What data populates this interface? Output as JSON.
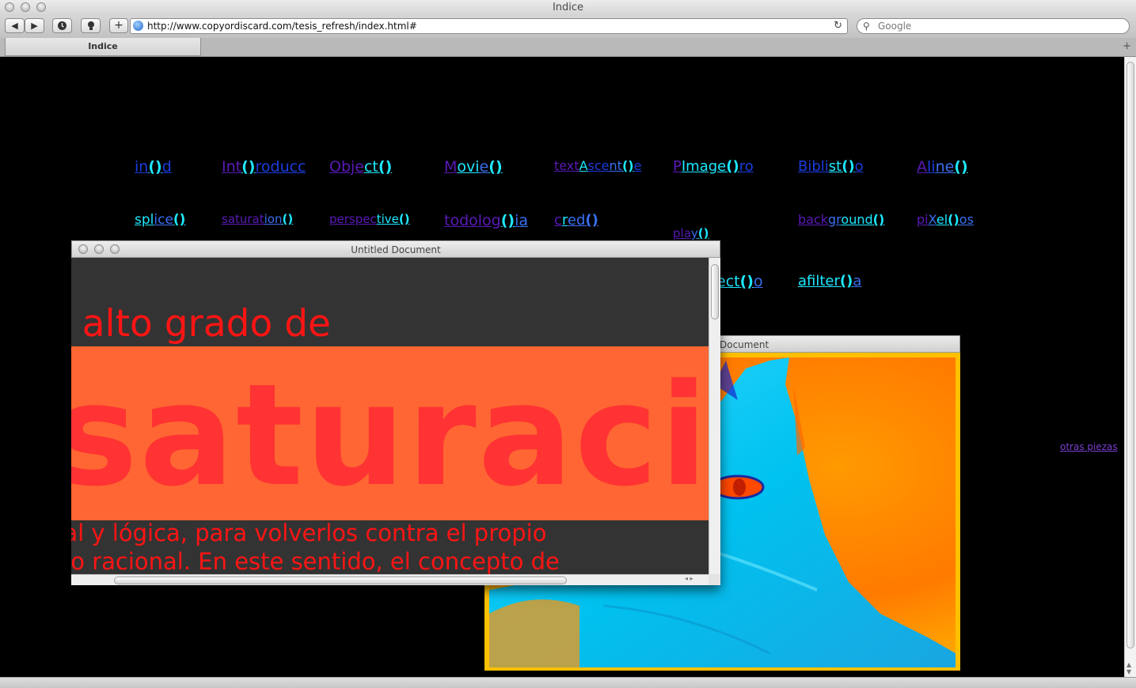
{
  "window": {
    "title": "Indice"
  },
  "toolbar": {
    "back": "◀",
    "forward": "▶",
    "add": "+",
    "url": "http://www.copyordiscard.com/tesis_refresh/index.html#",
    "reload": "↻",
    "search_placeholder": "Google"
  },
  "tab": {
    "label": "Indice",
    "new": "+"
  },
  "links": [
    {
      "name": "link-ind",
      "parts": [
        [
          "in",
          "c2"
        ],
        [
          "()",
          "c3"
        ],
        [
          "d",
          "c2"
        ]
      ]
    },
    {
      "name": "link-introduccion",
      "parts": [
        [
          "Int",
          "c1"
        ],
        [
          "()",
          "c3"
        ],
        [
          "roducc",
          "c2"
        ]
      ]
    },
    {
      "name": "link-object",
      "parts": [
        [
          "Obje",
          "c1"
        ],
        [
          "ct",
          "c3"
        ],
        [
          "()",
          "c3"
        ]
      ]
    },
    {
      "name": "link-movie",
      "parts": [
        [
          "M",
          "c1"
        ],
        [
          "ovi",
          "c3"
        ],
        [
          "e",
          "c4"
        ],
        [
          "()",
          "c3"
        ]
      ]
    },
    {
      "name": "link-textascent",
      "parts": [
        [
          "text",
          "c1"
        ],
        [
          "A",
          "c3"
        ],
        [
          "sce",
          "c2"
        ],
        [
          "nt",
          "c4"
        ],
        [
          "()",
          "c3"
        ],
        [
          "e",
          "c2"
        ]
      ]
    },
    {
      "name": "link-pimage",
      "parts": [
        [
          "P",
          "c1"
        ],
        [
          "Image",
          "c3"
        ],
        [
          "()",
          "c3"
        ],
        [
          "ro",
          "c2"
        ]
      ]
    },
    {
      "name": "link-biblist",
      "parts": [
        [
          "Bibli",
          "c2"
        ],
        [
          "st",
          "c3"
        ],
        [
          "()",
          "c3"
        ],
        [
          "o",
          "c2"
        ]
      ]
    },
    {
      "name": "link-aline",
      "parts": [
        [
          "A",
          "c1"
        ],
        [
          "li",
          "c2"
        ],
        [
          "ne",
          "c4"
        ],
        [
          "()",
          "c3"
        ]
      ]
    },
    {
      "name": "link-splice",
      "parts": [
        [
          "spl",
          "c3"
        ],
        [
          "ice",
          "c4"
        ],
        [
          "()",
          "c3"
        ]
      ]
    },
    {
      "name": "link-saturation",
      "parts": [
        [
          "saturat",
          "c1"
        ],
        [
          "ion",
          "c4"
        ],
        [
          "()",
          "c3"
        ]
      ]
    },
    {
      "name": "link-perspective",
      "parts": [
        [
          "perspec",
          "c1"
        ],
        [
          "tiv",
          "c3"
        ],
        [
          "e",
          "c3"
        ],
        [
          "()",
          "c3"
        ]
      ]
    },
    {
      "name": "link-todologia",
      "parts": [
        [
          "todolog",
          "c1"
        ],
        [
          "()",
          "c3"
        ],
        [
          "ia",
          "c4"
        ]
      ]
    },
    {
      "name": "link-cred",
      "parts": [
        [
          "c",
          "c1"
        ],
        [
          "r",
          "c3"
        ],
        [
          "ed",
          "c4"
        ],
        [
          "()",
          "c4"
        ]
      ]
    },
    {
      "name": "link-play",
      "parts": [
        [
          "pla",
          "c1"
        ],
        [
          "y",
          "c4"
        ],
        [
          "()",
          "c3"
        ]
      ]
    },
    {
      "name": "link-background",
      "parts": [
        [
          "back",
          "c1"
        ],
        [
          "gr",
          "c4"
        ],
        [
          "ound",
          "c3"
        ],
        [
          "()",
          "c3"
        ]
      ]
    },
    {
      "name": "link-pixelos",
      "parts": [
        [
          "pi",
          "c1"
        ],
        [
          "X",
          "c4"
        ],
        [
          "el",
          "c3"
        ],
        [
          "()",
          "c3"
        ],
        [
          "os",
          "c4"
        ]
      ]
    },
    {
      "name": "link-ecto",
      "parts": [
        [
          "ect",
          "c3"
        ],
        [
          "()",
          "c3"
        ],
        [
          "o",
          "c4"
        ]
      ]
    },
    {
      "name": "link-afilter",
      "parts": [
        [
          "afi",
          "c3"
        ],
        [
          "lter",
          "c3"
        ],
        [
          "()",
          "c3"
        ],
        [
          "a",
          "c4"
        ]
      ]
    }
  ],
  "otras": "otras piezas",
  "image_window": {
    "title": "Document"
  },
  "text_window": {
    "title": "Untitled Document",
    "line1": "a alto grado de",
    "bigword": "saturació",
    "para1": "nal y lógica, para volverlos contra el propio",
    "para2": "rco racional. En este sentido, el concepto de"
  }
}
